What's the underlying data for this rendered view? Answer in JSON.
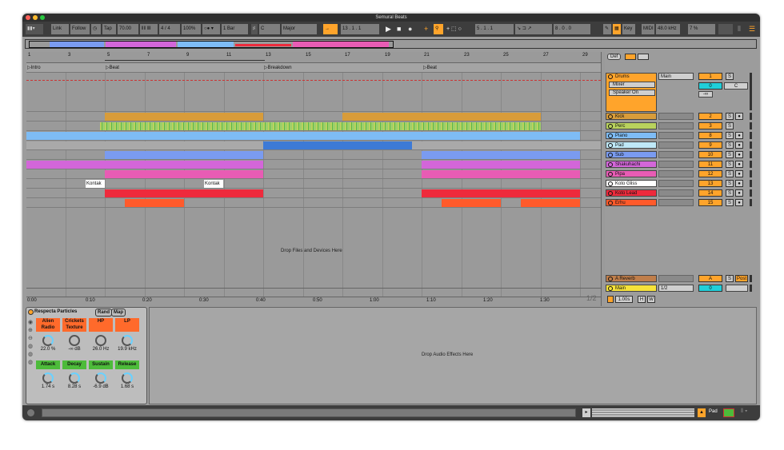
{
  "app": {
    "title": "Semural Beats"
  },
  "control_bar": {
    "link": "Link",
    "follow": "Follow",
    "tap": "Tap",
    "tempo": "70.00",
    "signature": "4 / 4",
    "zoom": "100%",
    "quantize": "1 Bar",
    "key": "C",
    "scale": "Major",
    "position": "13 .  1 .  1",
    "loop_start": "5 .  1 .  1",
    "loop_length": "8 .  0 .  0",
    "key_map": "Key",
    "midi_map": "MIDI",
    "sample_rate": "48.0 kHz",
    "cpu": "7 %"
  },
  "ruler": {
    "bars": [
      "1",
      "3",
      "5",
      "7",
      "9",
      "11",
      "13",
      "15",
      "17",
      "19",
      "21",
      "23",
      "25",
      "27",
      "29"
    ],
    "time": [
      "0:00",
      "0:10",
      "0:20",
      "0:30",
      "0:40",
      "0:50",
      "1:00",
      "1:10",
      "1:20",
      "1:30"
    ]
  },
  "locators": [
    {
      "label": "Intro"
    },
    {
      "label": "Beat"
    },
    {
      "label": "Breakdown"
    },
    {
      "label": "Beat"
    }
  ],
  "tracks": [
    {
      "name": "Drums",
      "color": "#ffa42b",
      "num": "1",
      "group": true,
      "routing": "Main",
      "sub1": "Mixer",
      "sub2": "Speaker On",
      "vol": "0",
      "pan": "C",
      "send": "-∞"
    },
    {
      "name": "Kick",
      "color": "#d89c3a",
      "num": "2"
    },
    {
      "name": "Perc",
      "color": "#b9d25d",
      "num": "3"
    },
    {
      "name": "Piano",
      "color": "#7ebcf5",
      "num": "8"
    },
    {
      "name": "Pad",
      "color": "#bfe8f7",
      "num": "9"
    },
    {
      "name": "Sub",
      "color": "#7a9bf0",
      "num": "10"
    },
    {
      "name": "Shakuhachi",
      "color": "#d366d9",
      "num": "11"
    },
    {
      "name": "Pipa",
      "color": "#e85cb4",
      "num": "12"
    },
    {
      "name": "Koto Gliss",
      "color": "#ffffff",
      "num": "13"
    },
    {
      "name": "Koto Lead",
      "color": "#ee2a3c",
      "num": "14"
    },
    {
      "name": "Erhu",
      "color": "#ff5a2b",
      "num": "15"
    }
  ],
  "clip_labels": {
    "kontakt": "Kontak"
  },
  "returns": [
    {
      "name": "A Reverb",
      "num": "A"
    }
  ],
  "main": {
    "name": "Main",
    "num": "0",
    "routing": "1/2",
    "post": "Post",
    "solo": "S",
    "cue": "1/2",
    "delay": "1.00s",
    "h": "H",
    "w": "W"
  },
  "arrangement": {
    "drop_label": "Drop Files and Devices Here",
    "def": "Def"
  },
  "device": {
    "name": "Respecta Particles",
    "rand": "Rand",
    "map": "Map",
    "macros": [
      {
        "label": "Alien Radio",
        "value": "22.0 %"
      },
      {
        "label": "Crickets Texture",
        "value": "-∞ dB"
      },
      {
        "label": "HP",
        "value": "26.0 Hz"
      },
      {
        "label": "LP",
        "value": "19.9 kHz"
      },
      {
        "label": "Attack",
        "value": "1.74 s"
      },
      {
        "label": "Decay",
        "value": "8.28 s"
      },
      {
        "label": "Sustain",
        "value": "-6.9 dB"
      },
      {
        "label": "Release",
        "value": "1.68 s"
      }
    ]
  },
  "fx": {
    "drop_label": "Drop Audio Effects Here"
  },
  "status": {
    "track": "Pad"
  },
  "colors": {
    "accent": "#ffa42b",
    "window": "#3d3d3d",
    "arrangement": "#9a9a9a"
  }
}
